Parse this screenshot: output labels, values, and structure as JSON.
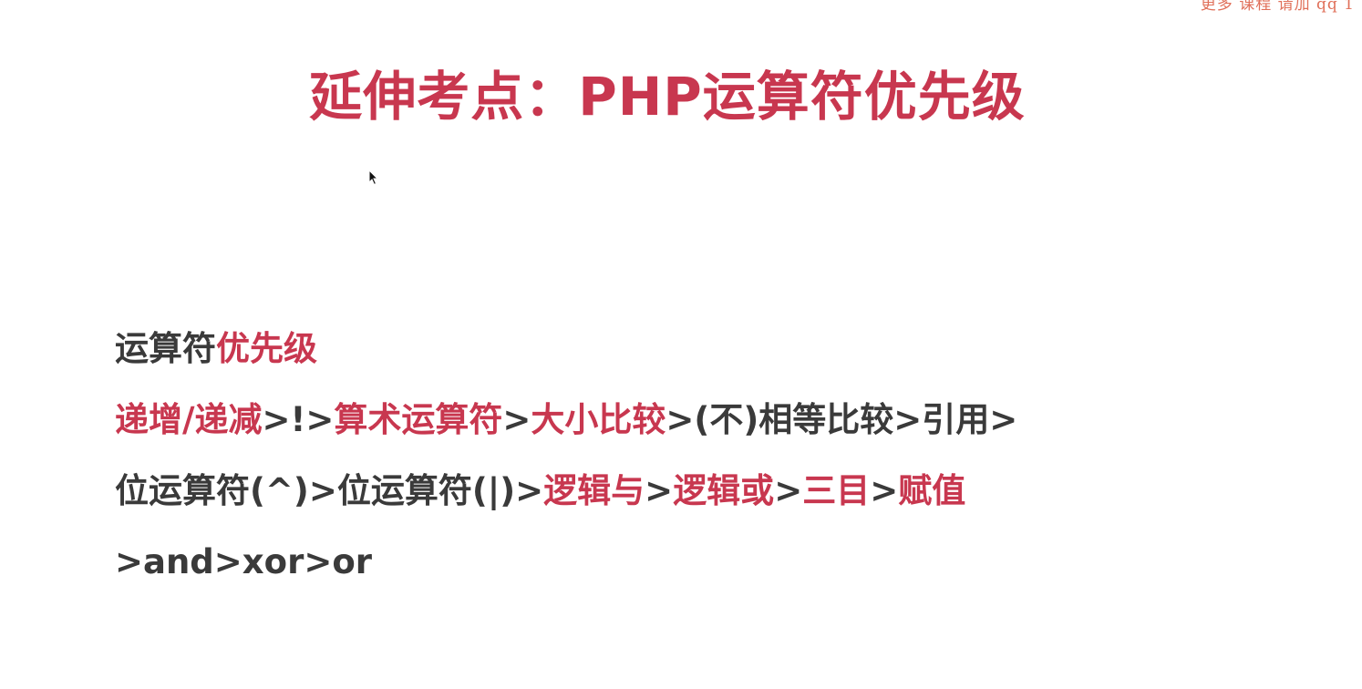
{
  "colors": {
    "accent": "#c8374f",
    "text": "#3a3a3a",
    "watermark": "#e0705a",
    "background": "#ffffff"
  },
  "watermark": "更多 课程 请加 qq 1",
  "title": "延伸考点：PHP运算符优先级",
  "heading": {
    "prefix": "运算符",
    "highlight": "优先级"
  },
  "lines": [
    [
      {
        "text": "递增/递减",
        "hl": true
      },
      {
        "text": ">!>",
        "hl": false
      },
      {
        "text": "算术运算符",
        "hl": true
      },
      {
        "text": ">",
        "hl": false
      },
      {
        "text": "大小比较",
        "hl": true
      },
      {
        "text": ">(不)相等比较>引用>",
        "hl": false
      }
    ],
    [
      {
        "text": "位运算符(^)>位运算符(|)>",
        "hl": false
      },
      {
        "text": "逻辑与",
        "hl": true
      },
      {
        "text": ">",
        "hl": false
      },
      {
        "text": "逻辑或",
        "hl": true
      },
      {
        "text": ">",
        "hl": false
      },
      {
        "text": "三目",
        "hl": true
      },
      {
        "text": ">",
        "hl": false
      },
      {
        "text": "赋值",
        "hl": true
      }
    ],
    [
      {
        "text": ">and>xor>or",
        "hl": false
      }
    ]
  ]
}
